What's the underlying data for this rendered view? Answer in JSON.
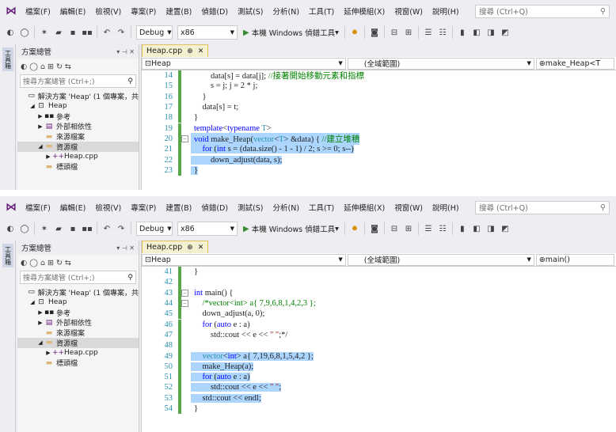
{
  "menu": {
    "items": [
      "檔案(F)",
      "編輯(E)",
      "檢視(V)",
      "專案(P)",
      "建置(B)",
      "偵錯(D)",
      "測試(S)",
      "分析(N)",
      "工具(T)",
      "延伸模組(X)",
      "視窗(W)",
      "說明(H)"
    ],
    "search_placeholder": "搜尋 (Ctrl+Q)"
  },
  "toolbar": {
    "config": "Debug",
    "platform": "x86",
    "run_label": "本機 Windows 偵錯工具"
  },
  "side_strip": {
    "label": "工具箱"
  },
  "solution": {
    "title": "方案總管",
    "search_placeholder": "搜尋方案總管 (Ctrl+;)",
    "tree": [
      {
        "label": "解決方案 'Heap' (1 個專案，共",
        "indent": 0,
        "icon": "solution-icon"
      },
      {
        "label": "Heap",
        "indent": 1,
        "icon": "project-icon"
      },
      {
        "label": "參考",
        "indent": 2,
        "icon": "references-icon"
      },
      {
        "label": "外部相依性",
        "indent": 2,
        "icon": "external-deps-icon"
      },
      {
        "label": "來源檔案",
        "indent": 2,
        "icon": "folder-icon"
      },
      {
        "label": "資源檔",
        "indent": 2,
        "icon": "folder-icon"
      },
      {
        "label": "Heap.cpp",
        "indent": 3,
        "icon": "cpp-file-icon"
      },
      {
        "label": "標頭檔",
        "indent": 2,
        "icon": "folder-icon"
      }
    ]
  },
  "shots": [
    {
      "tab_label": "Heap.cpp",
      "nav": {
        "project": "Heap",
        "scope": "(全域範圍)",
        "member": "make_Heap<T"
      },
      "lines": [
        {
          "n": "14",
          "text": "        data[s] = data[j]; //接著開始移動元素和指標",
          "hl": false
        },
        {
          "n": "15",
          "text": "        s = j; j = 2 * j;",
          "hl": false
        },
        {
          "n": "16",
          "text": "    }",
          "hl": false
        },
        {
          "n": "17",
          "text": "    data[s] = t;",
          "hl": false
        },
        {
          "n": "18",
          "text": "}",
          "hl": false
        },
        {
          "n": "19",
          "text": "template<typename T>",
          "hl": false
        },
        {
          "n": "20",
          "text": "void make_Heap(vector<T> &data) { //建立堆積",
          "hl": true
        },
        {
          "n": "21",
          "text": "    for (int s = (data.size() - 1 - 1) / 2; s >= 0; s--)",
          "hl": true
        },
        {
          "n": "22",
          "text": "        down_adjust(data, s);",
          "hl": true
        },
        {
          "n": "23",
          "text": "}",
          "hl": true
        }
      ]
    },
    {
      "tab_label": "Heap.cpp",
      "nav": {
        "project": "Heap",
        "scope": "(全域範圍)",
        "member": "main()"
      },
      "lines": [
        {
          "n": "41",
          "text": "}",
          "hl": false
        },
        {
          "n": "42",
          "text": "",
          "hl": false
        },
        {
          "n": "43",
          "text": "int main() {",
          "hl": false
        },
        {
          "n": "44",
          "text": "    /*vector<int> a{ 7,9,6,8,1,4,2,3 };",
          "hl": false
        },
        {
          "n": "45",
          "text": "    down_adjust(a, 0);",
          "hl": false
        },
        {
          "n": "46",
          "text": "    for (auto e : a)",
          "hl": false
        },
        {
          "n": "47",
          "text": "        std::cout << e << \" \";*/",
          "hl": false
        },
        {
          "n": "48",
          "text": "",
          "hl": false
        },
        {
          "n": "49",
          "text": "    vector<int> a{ 7,19,6,8,1,5,4,2 };",
          "hl": true
        },
        {
          "n": "50",
          "text": "    make_Heap(a);",
          "hl": true
        },
        {
          "n": "51",
          "text": "    for (auto e : a)",
          "hl": true
        },
        {
          "n": "52",
          "text": "        std::cout << e << \" \";",
          "hl": true
        },
        {
          "n": "53",
          "text": "    std::cout << endl;",
          "hl": true
        },
        {
          "n": "54",
          "text": "}",
          "hl": false
        }
      ]
    }
  ],
  "colors": {
    "accent": "#68217a",
    "selection": "#add6ff",
    "keyword": "#0000ff",
    "comment": "#008000",
    "type": "#2b91af",
    "change_bar": "#57a64a"
  }
}
